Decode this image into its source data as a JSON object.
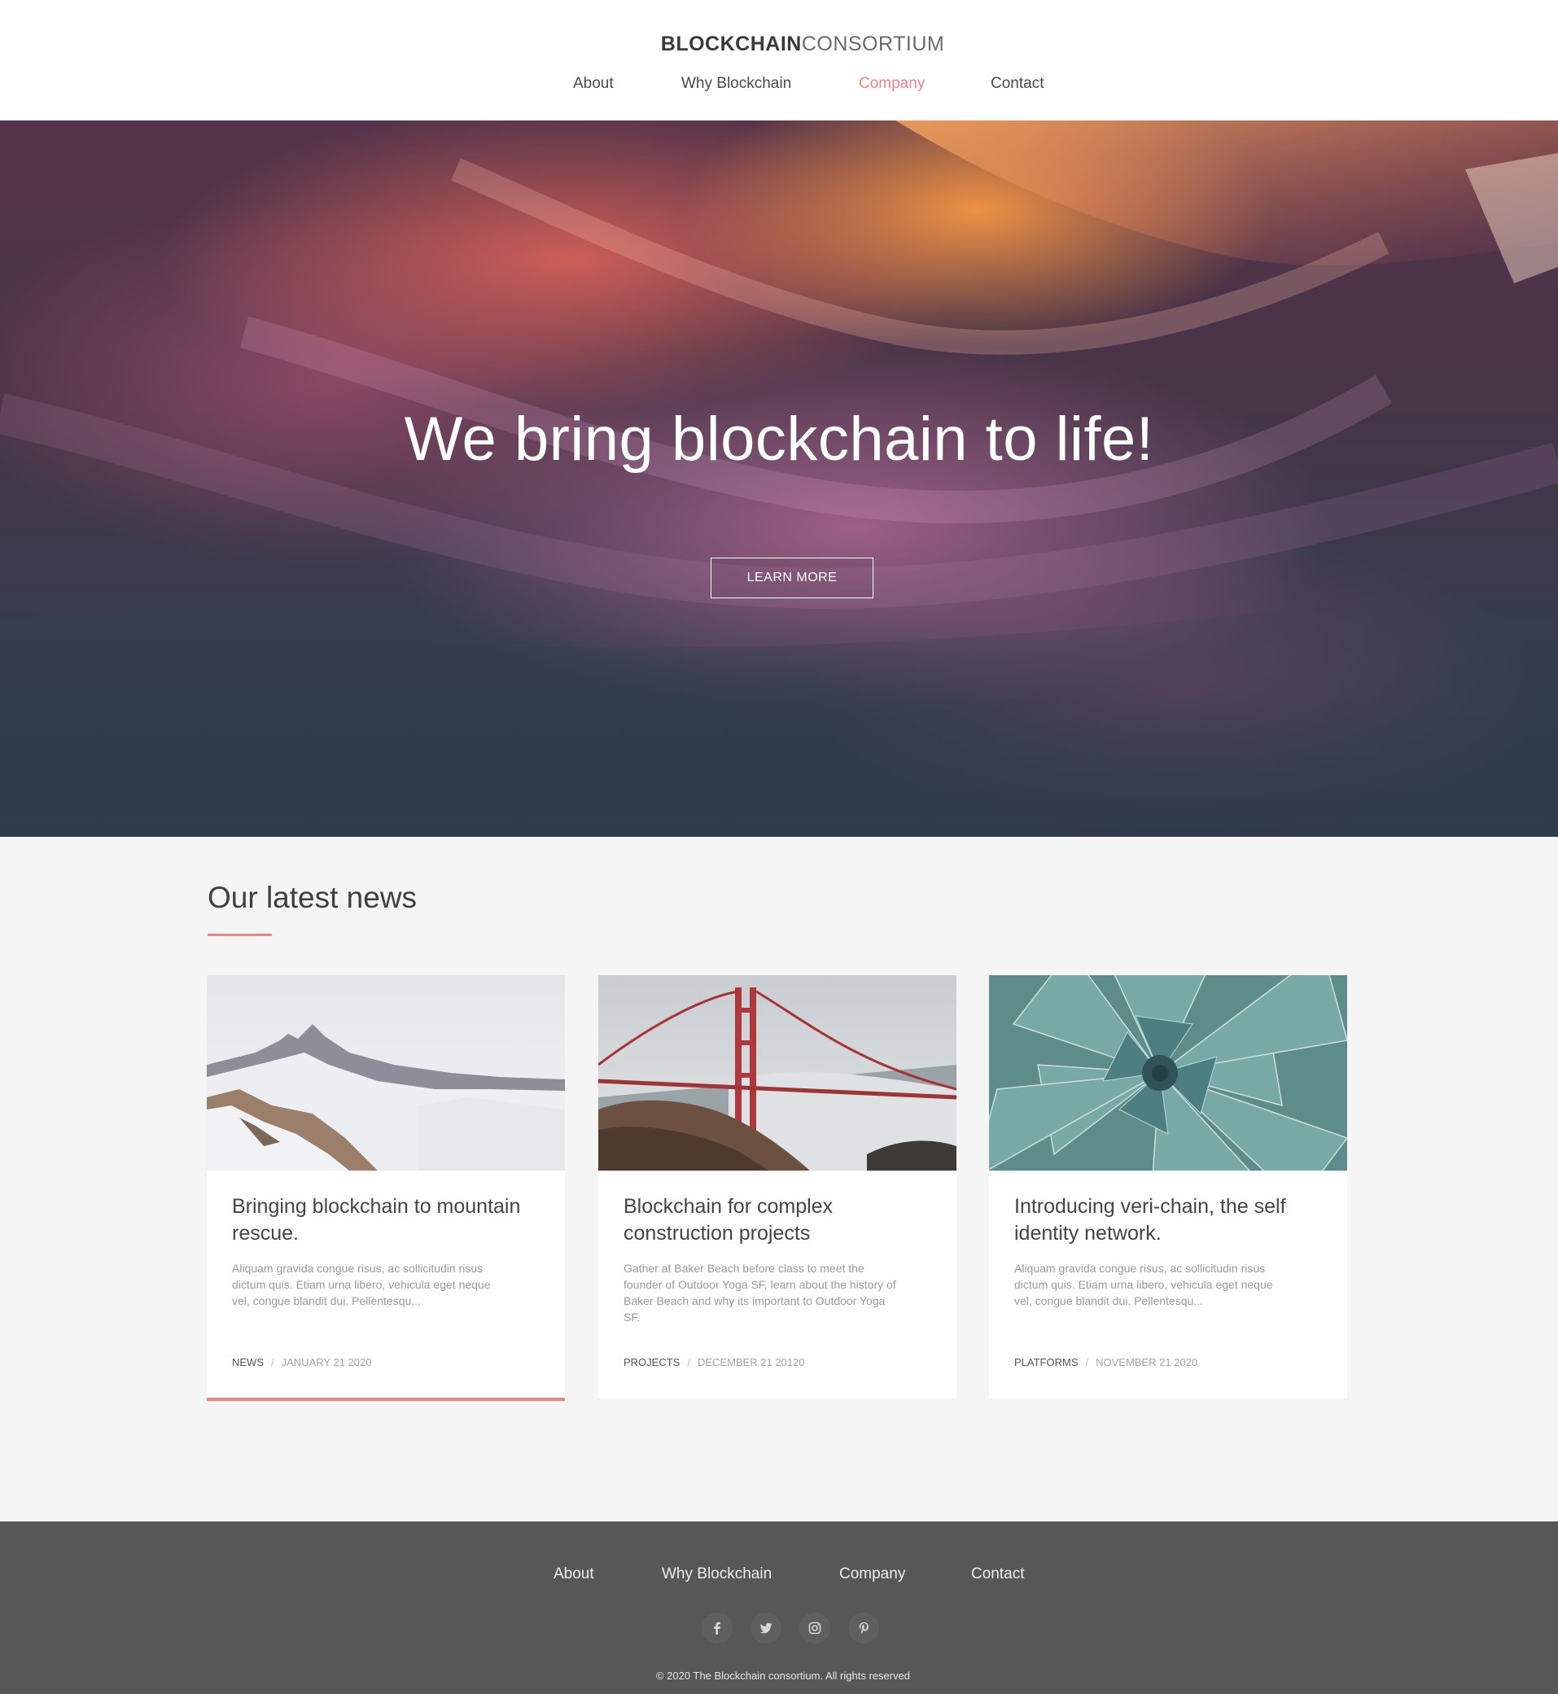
{
  "header": {
    "logo_bold": "BLOCKCHAIN",
    "logo_light": "CONSORTIUM",
    "nav": [
      {
        "label": "About"
      },
      {
        "label": "Why Blockchain"
      },
      {
        "label": "Company"
      },
      {
        "label": "Contact"
      }
    ],
    "active_nav": "Company"
  },
  "hero": {
    "title": "We bring blockchain to life!",
    "button_label": "LEARN MORE"
  },
  "news": {
    "title": "Our latest news",
    "cards": [
      {
        "image": "snowy-mountains-photo",
        "title": "Bringing blockchain to mountain rescue.",
        "excerpt": "Aliquam gravida congue risus, ac sollicitudin risus dictum quis. Etiam urna libero, vehicula eget neque vel, congue blandit dui. Pellentesqu...",
        "category": "NEWS",
        "date": "JANUARY 21 2020"
      },
      {
        "image": "golden-gate-bridge-fog-photo",
        "title": "Blockchain for complex construction projects",
        "excerpt": "Gather at Baker Beach before class to meet the founder of Outdoor Yoga SF, learn about the history of Baker Beach and why its important to Outdoor Yoga SF.",
        "category": "PROJECTS",
        "date": "DECEMBER  21 20120"
      },
      {
        "image": "agave-succulent-photo",
        "title": "Introducing veri-chain, the self identity network.",
        "excerpt": "Aliquam gravida congue risus, ac sollicitudin risus dictum quis. Etiam urna libero, vehicula eget neque vel, congue blandit dui. Pellentesqu...",
        "category": "PLATFORMS",
        "date": "NOVEMBER 21 2020"
      }
    ]
  },
  "footer": {
    "nav": [
      {
        "label": "About"
      },
      {
        "label": "Why Blockchain"
      },
      {
        "label": "Company"
      },
      {
        "label": "Contact"
      }
    ],
    "social": [
      {
        "icon": "facebook-icon",
        "glyph": "f"
      },
      {
        "icon": "twitter-icon",
        "glyph": "t"
      },
      {
        "icon": "instagram-icon",
        "glyph": "◎"
      },
      {
        "icon": "pinterest-icon",
        "glyph": "p"
      }
    ],
    "copyright": "© 2020 The Blockchain consortium. All rights reserved"
  },
  "colors": {
    "accent": "#f08484",
    "footer_bg": "#575757",
    "page_bg": "#f5f5f5"
  }
}
